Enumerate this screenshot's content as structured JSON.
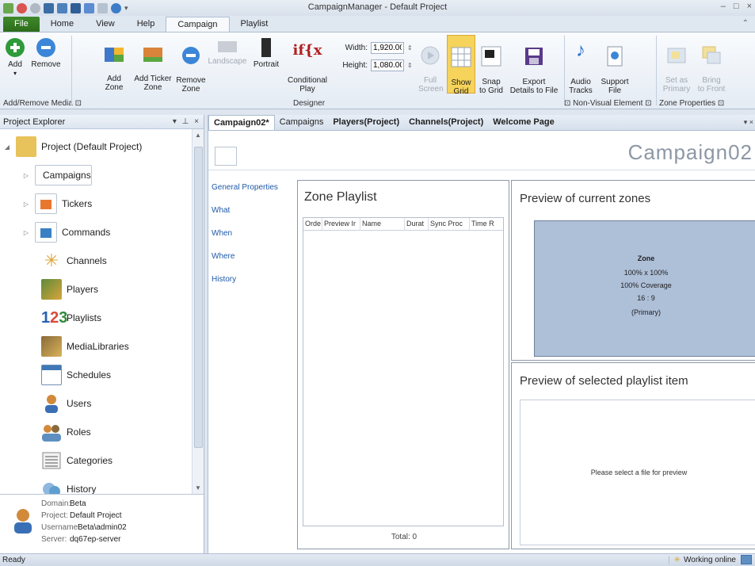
{
  "window": {
    "title": "CampaignManager - Default Project",
    "min": "–",
    "max": "□",
    "close": "×"
  },
  "ribbon_tabs": [
    "File",
    "Home",
    "View",
    "Help",
    "Campaign",
    "Playlist"
  ],
  "ribbon": {
    "add": "Add",
    "remove": "Remove",
    "add_zone": "Add\nZone",
    "add_ticker_zone": "Add Ticker\nZone",
    "remove_zone": "Remove\nZone",
    "landscape": "Landscape",
    "portrait": "Portrait",
    "conditional_play": "Conditional\nPlay",
    "width_label": "Width:",
    "width_value": "1,920.00",
    "height_label": "Height:",
    "height_value": "1,080.00",
    "full_screen": "Full\nScreen",
    "show_grid": "Show\nGrid",
    "snap_to_grid": "Snap\nto Grid",
    "export_details": "Export\nDetails to File",
    "audio_tracks": "Audio\nTracks",
    "support_file": "Support\nFile",
    "set_as_primary": "Set as\nPrimary",
    "bring_to_front": "Bring\nto Front",
    "group_add_remove": "Add/Remove Media ⊡",
    "group_designer": "Designer",
    "group_non_visual": "⊡ Non-Visual Element ⊡",
    "group_zone_properties": "Zone Properties ⊡"
  },
  "project_explorer": {
    "title": "Project Explorer",
    "controls": "▾ ⊥ ×",
    "root": "Project (Default Project)",
    "items": [
      {
        "label": "Campaigns",
        "icon": "campaign-icon",
        "color": "#ffffff"
      },
      {
        "label": "Tickers",
        "icon": "ticker-icon",
        "color": "#e8772e"
      },
      {
        "label": "Commands",
        "icon": "command-icon",
        "color": "#3b7fc4"
      },
      {
        "label": "Channels",
        "icon": "channel-icon",
        "color": "#d9a43a"
      },
      {
        "label": "Players",
        "icon": "player-icon",
        "color": "#5d8a3b"
      },
      {
        "label": "Playlists",
        "icon": "playlist-icon",
        "color": "#2860b0"
      },
      {
        "label": "MediaLibraries",
        "icon": "media-library-icon",
        "color": "#8a6a3a"
      },
      {
        "label": "Schedules",
        "icon": "schedule-icon",
        "color": "#3f78b5"
      },
      {
        "label": "Users",
        "icon": "user-icon",
        "color": "#d28a3a"
      },
      {
        "label": "Roles",
        "icon": "role-icon",
        "color": "#5f8fc0"
      },
      {
        "label": "Categories",
        "icon": "category-icon",
        "color": "#7a7a7a"
      },
      {
        "label": "History",
        "icon": "history-icon",
        "color": "#5f9fd0"
      }
    ],
    "info": {
      "domain_key": "Domain:",
      "domain_val": "Beta",
      "project_key": "Project:",
      "project_val": "Default Project",
      "username_key": "Username:",
      "username_val": "Beta\\admin02",
      "server_key": "Server:",
      "server_val": "dq67ep-server"
    }
  },
  "doc_tabs": [
    "Campaign02*",
    "Campaigns",
    "Players(Project)",
    "Channels(Project)",
    "Welcome Page"
  ],
  "doc_ctrl": "▾ ×",
  "campaign_title": "Campaign02",
  "side_nav": [
    "General Properties",
    "What",
    "When",
    "Where",
    "History"
  ],
  "zone_playlist": {
    "title": "Zone Playlist",
    "columns": [
      "Orde",
      "Preview Ir",
      "Name",
      "Durat",
      "Sync Proc",
      "Time R"
    ],
    "total": "Total: 0"
  },
  "preview_zones": {
    "title": "Preview of current zones",
    "zone_name": "Zone",
    "zone_size": "100% x 100%",
    "zone_coverage": "100% Coverage",
    "zone_ratio": "16 : 9",
    "zone_primary": "(Primary)"
  },
  "preview_item": {
    "title": "Preview of selected playlist item",
    "message": "Please select a file for preview"
  },
  "status": {
    "left": "Ready",
    "online": "Working online"
  },
  "colors": {
    "file_tab": "#3f8a2b",
    "show_grid_active": "#f6d35a",
    "zone_fill": "#aebfd8",
    "accent_link": "#1f5aa8"
  }
}
